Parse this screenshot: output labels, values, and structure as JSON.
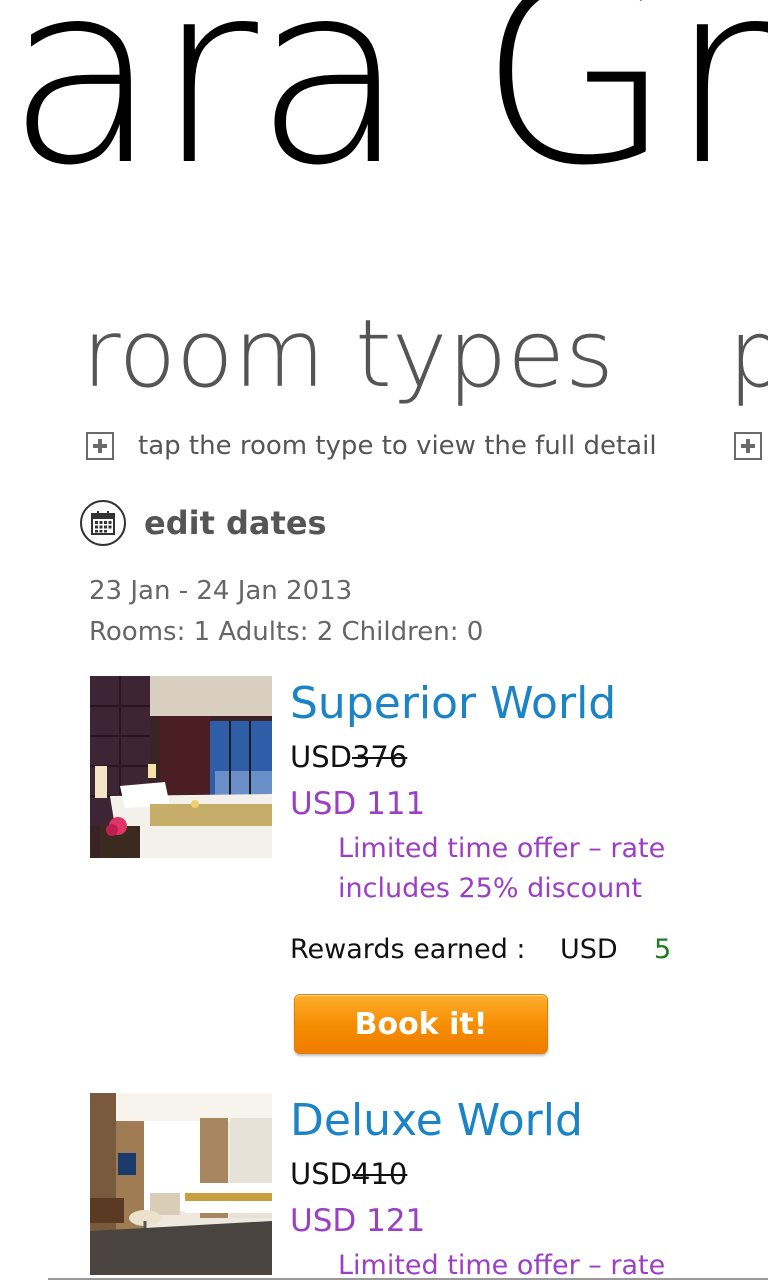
{
  "app": {
    "pano_title": "ara Gra",
    "next_section_letter": "p"
  },
  "section": {
    "title": "room types",
    "hint": "tap the room type to view the full detail"
  },
  "edit_dates": {
    "label": "edit dates"
  },
  "stay": {
    "dates": "23 Jan - 24 Jan 2013",
    "guests": "Rooms: 1 Adults: 2 Children: 0"
  },
  "rooms": [
    {
      "name": "Superior World",
      "orig_currency": "USD",
      "orig_price": "376",
      "new_price": "USD  111",
      "offer": "Limited time offer – rate includes 25% discount",
      "rewards_label": "Rewards earned :",
      "rewards_currency": "USD",
      "rewards_amount": "5",
      "book_label": "Book it!"
    },
    {
      "name": "Deluxe World",
      "orig_currency": "USD",
      "orig_price": "410",
      "new_price": "USD  121",
      "offer": "Limited time offer – rate"
    }
  ],
  "colors": {
    "link_blue": "#1b83c6",
    "offer_purple": "#9b3fc4",
    "rewards_green": "#1f7d1f",
    "book_orange": "#f58c00"
  },
  "icons": {
    "expand": "plus-box-icon",
    "calendar": "calendar-icon"
  }
}
